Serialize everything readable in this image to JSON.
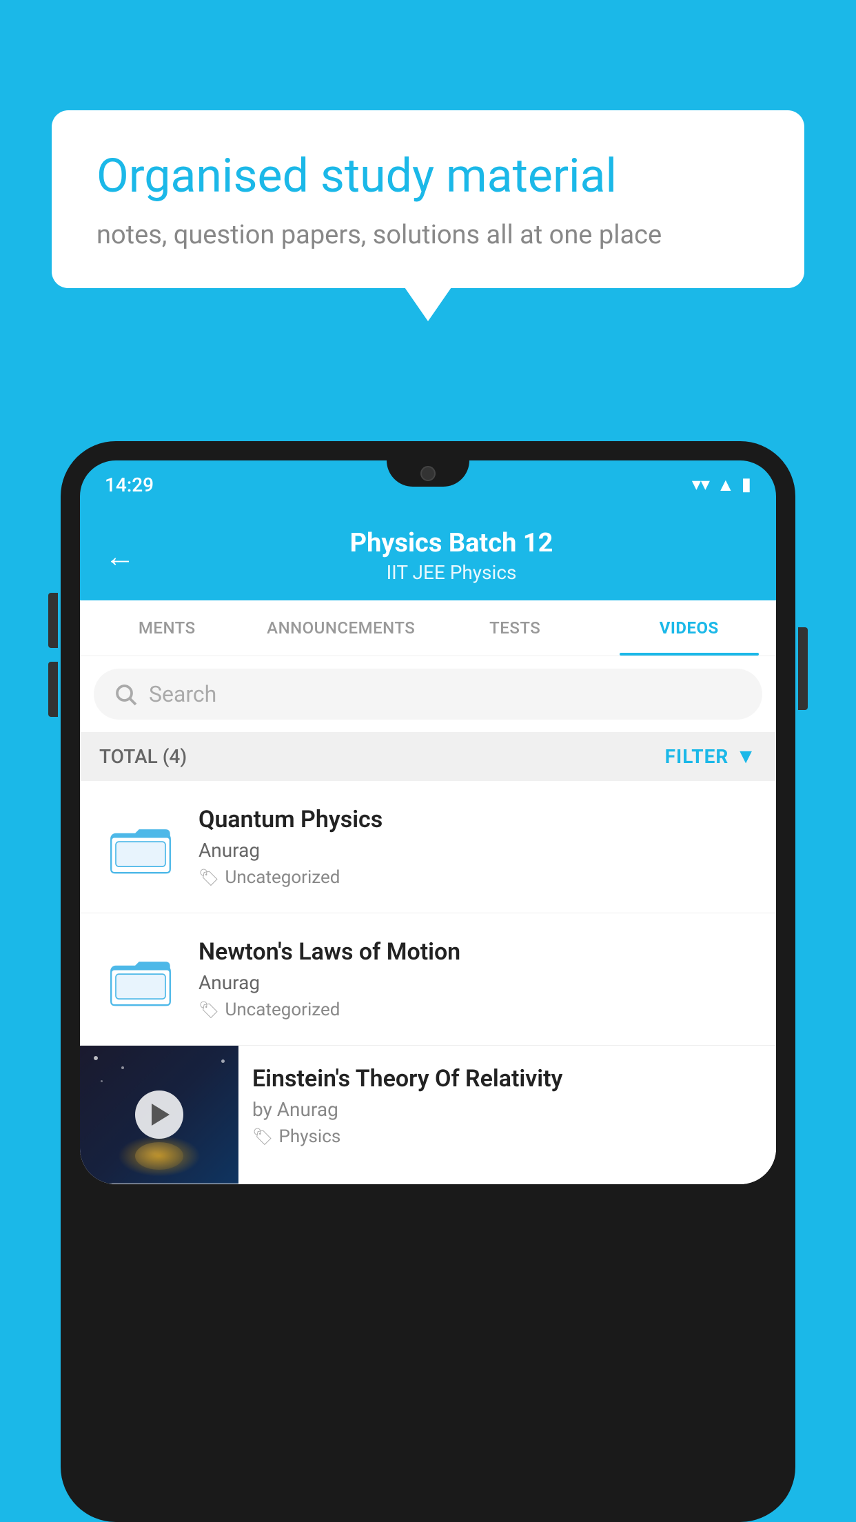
{
  "bubble": {
    "title": "Organised study material",
    "subtitle": "notes, question papers, solutions all at one place"
  },
  "status_bar": {
    "time": "14:29"
  },
  "header": {
    "title": "Physics Batch 12",
    "subtitle": "IIT JEE   Physics"
  },
  "tabs": [
    {
      "label": "MENTS",
      "active": false
    },
    {
      "label": "ANNOUNCEMENTS",
      "active": false
    },
    {
      "label": "TESTS",
      "active": false
    },
    {
      "label": "VIDEOS",
      "active": true
    }
  ],
  "search": {
    "placeholder": "Search"
  },
  "filter_bar": {
    "total_label": "TOTAL (4)",
    "filter_label": "FILTER"
  },
  "videos": [
    {
      "title": "Quantum Physics",
      "author": "Anurag",
      "tag": "Uncategorized",
      "type": "folder"
    },
    {
      "title": "Newton's Laws of Motion",
      "author": "Anurag",
      "tag": "Uncategorized",
      "type": "folder"
    },
    {
      "title": "Einstein's Theory Of Relativity",
      "author": "by Anurag",
      "tag": "Physics",
      "type": "video"
    }
  ]
}
